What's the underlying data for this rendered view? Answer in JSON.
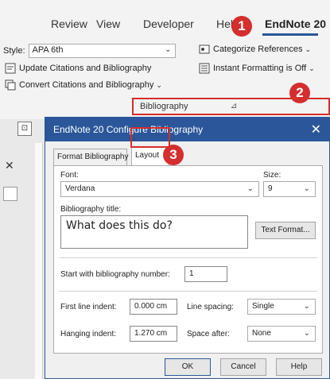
{
  "ribbon": {
    "tabs": [
      "Review",
      "View",
      "Developer",
      "Help",
      "EndNote 20"
    ],
    "style_label": "Style:",
    "style_value": "APA 6th",
    "update_citations": "Update Citations and Bibliography",
    "convert_citations": "Convert Citations and Bibliography",
    "categorize_references": "Categorize References",
    "instant_formatting": "Instant Formatting is Off",
    "group_label": "Bibliography"
  },
  "badges": [
    "1",
    "2",
    "3"
  ],
  "dialog": {
    "title": "EndNote 20 Configure Bibliography",
    "tabs": [
      "Format Bibliography",
      "Layout"
    ],
    "font_label": "Font:",
    "font_value": "Verdana",
    "size_label": "Size:",
    "size_value": "9",
    "bib_title_label": "Bibliography title:",
    "bib_title_value": "What does this do?",
    "text_format_button": "Text Format...",
    "start_number_label": "Start with bibliography number:",
    "start_number_value": "1",
    "first_line_indent_label": "First line indent:",
    "first_line_indent_value": "0.000 cm",
    "line_spacing_label": "Line spacing:",
    "line_spacing_value": "Single",
    "hanging_indent_label": "Hanging indent:",
    "hanging_indent_value": "1.270 cm",
    "space_after_label": "Space after:",
    "space_after_value": "None",
    "ok_button": "OK",
    "cancel_button": "Cancel",
    "help_button": "Help"
  },
  "colors": {
    "accent": "#2b579a",
    "highlight": "#d42e2e"
  }
}
